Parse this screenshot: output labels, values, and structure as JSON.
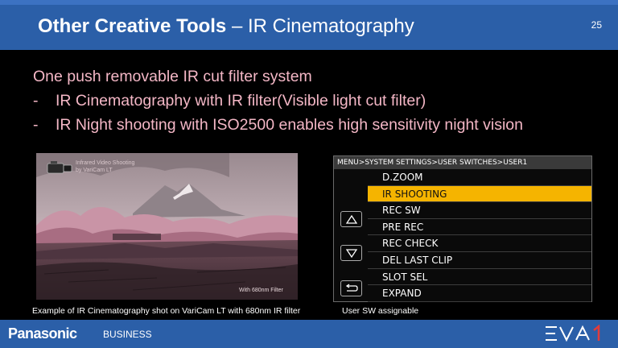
{
  "header": {
    "title_bold": "Other Creative Tools",
    "title_rest": " – IR Cinematography",
    "page_number": "25"
  },
  "body": {
    "line1": "One push removable IR cut filter system",
    "bullets": [
      {
        "dash": "-",
        "text": "IR Cinematography with IR filter(Visible light cut filter)"
      },
      {
        "dash": "-",
        "text": "IR Night shooting with ISO2500 enables high sensitivity night vision"
      }
    ]
  },
  "photo": {
    "overlay_line1": "Infrared Video Shooting",
    "overlay_line2": "by VariCam LT",
    "overlay_filter": "With 680nm Filter",
    "caption": "Example of IR Cinematography shot on VariCam LT with 680nm IR filter"
  },
  "menu": {
    "path": "MENU>SYSTEM SETTINGS>USER SWITCHES>USER1",
    "items": [
      "D.ZOOM",
      "IR SHOOTING",
      "REC SW",
      "PRE REC",
      "REC CHECK",
      "DEL LAST CLIP",
      "SLOT SEL",
      "EXPAND"
    ],
    "selected_index": 1,
    "selected_color": "#f5b400",
    "buttons": [
      "up-arrow-icon",
      "down-arrow-icon",
      "return-icon"
    ],
    "caption": "User SW assignable"
  },
  "footer": {
    "brand": "Panasonic",
    "division": "BUSINESS",
    "product_logo": "EVA1"
  },
  "colors": {
    "header_blue": "#2b5fa8",
    "body_text_pink": "#f4b7c6"
  }
}
